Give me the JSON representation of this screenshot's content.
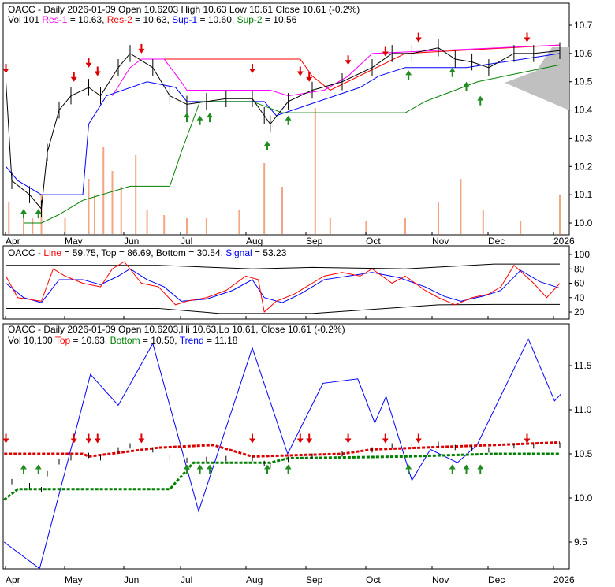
{
  "header1": {
    "line1": "OACC - Daily 2026-01-09 Open 10.6203  High 10.63  Low 10.61  Close 10.61 (-0.2%)",
    "vol": "Vol 101 ",
    "res1": "Res-1",
    "res1v": " = 10.63, ",
    "res2": "Res-2",
    "res2v": " = 10.63, ",
    "sup1": "Sup-1",
    "sup1v": " = 10.60, ",
    "sup2": "Sup-2",
    "sup2v": " = 10.56"
  },
  "header2": {
    "pre": "OACC - ",
    "line": "Line",
    "linev": " = 59.75, Top = 86.69, Bottom = 30.54, ",
    "signal": "Signal",
    "signalv": " = 53.23"
  },
  "header3": {
    "line1": "OACC - Daily 2026-01-09 Open 10.6203,Hi 10.63,Lo 10.61, Close 10.61 (-0.2%)",
    "vol": "Vol 10,100 ",
    "top": "Top",
    "topv": " = 10.63, ",
    "bottom": "Bottom",
    "bottomv": " = 10.50, ",
    "trend": "Trend",
    "trendv": " = 11.18"
  },
  "colors": {
    "res1": "#ff00ff",
    "res2": "#ff0000",
    "sup1": "#0000ff",
    "sup2": "#008000",
    "volume": "#f4a582",
    "up": "#228b22",
    "down": "#dd0000"
  },
  "chart_data": [
    {
      "type": "line",
      "title": "Price with support/resistance",
      "months": [
        "Apr",
        "May",
        "Jun",
        "Jul",
        "Aug",
        "Sep",
        "Oct",
        "Nov",
        "Dec",
        "2026"
      ],
      "y_ticks": [
        "10.7",
        "10.6",
        "10.5",
        "10.4",
        "10.3",
        "10.2",
        "10.1",
        "10.0"
      ],
      "ylim": [
        9.97,
        10.76
      ],
      "price": [
        [
          -0.1,
          10.5
        ],
        [
          0.0,
          10.15
        ],
        [
          0.3,
          10.1
        ],
        [
          0.5,
          10.05
        ],
        [
          0.6,
          10.25
        ],
        [
          0.8,
          10.4
        ],
        [
          1.0,
          10.45
        ],
        [
          1.3,
          10.48
        ],
        [
          1.5,
          10.45
        ],
        [
          1.8,
          10.55
        ],
        [
          2.0,
          10.6
        ],
        [
          2.4,
          10.55
        ],
        [
          2.7,
          10.45
        ],
        [
          3.0,
          10.42
        ],
        [
          3.3,
          10.43
        ],
        [
          3.6,
          10.44
        ],
        [
          4.0,
          10.44
        ],
        [
          4.2,
          10.38
        ],
        [
          4.3,
          10.35
        ],
        [
          4.6,
          10.43
        ],
        [
          5.0,
          10.47
        ],
        [
          5.5,
          10.5
        ],
        [
          6.0,
          10.55
        ],
        [
          6.3,
          10.6
        ],
        [
          6.6,
          10.6
        ],
        [
          7.0,
          10.62
        ],
        [
          7.3,
          10.58
        ],
        [
          7.6,
          10.57
        ],
        [
          7.9,
          10.55
        ],
        [
          8.3,
          10.6
        ],
        [
          8.6,
          10.6
        ],
        [
          9.0,
          10.61
        ]
      ],
      "res2": [
        [
          2.3,
          10.58
        ],
        [
          4.8,
          10.58
        ],
        [
          5.0,
          10.52
        ],
        [
          5.3,
          10.47
        ],
        [
          6.5,
          10.6
        ],
        [
          9.0,
          10.63
        ]
      ],
      "res1": [
        [
          1.7,
          10.45
        ],
        [
          2.0,
          10.55
        ],
        [
          2.2,
          10.58
        ],
        [
          2.6,
          10.58
        ],
        [
          2.9,
          10.5
        ],
        [
          3.0,
          10.47
        ],
        [
          4.3,
          10.47
        ],
        [
          4.6,
          10.45
        ],
        [
          5.2,
          10.47
        ],
        [
          5.6,
          10.52
        ],
        [
          6.0,
          10.6
        ],
        [
          9.0,
          10.63
        ]
      ],
      "sup1": [
        [
          -0.1,
          10.2
        ],
        [
          0.1,
          10.15
        ],
        [
          0.5,
          10.1
        ],
        [
          1.2,
          10.1
        ],
        [
          1.3,
          10.35
        ],
        [
          1.6,
          10.45
        ],
        [
          2.3,
          10.5
        ],
        [
          2.8,
          10.48
        ],
        [
          3.0,
          10.43
        ],
        [
          4.2,
          10.43
        ],
        [
          4.4,
          10.38
        ],
        [
          5.8,
          10.48
        ],
        [
          6.1,
          10.52
        ],
        [
          6.5,
          10.55
        ],
        [
          7.5,
          10.55
        ],
        [
          9.0,
          10.6
        ]
      ],
      "sup2": [
        [
          0.2,
          10.0
        ],
        [
          0.5,
          10.0
        ],
        [
          0.8,
          10.03
        ],
        [
          1.2,
          10.08
        ],
        [
          2.0,
          10.13
        ],
        [
          2.7,
          10.13
        ],
        [
          2.9,
          10.25
        ],
        [
          3.2,
          10.43
        ],
        [
          4.0,
          10.43
        ],
        [
          4.5,
          10.39
        ],
        [
          6.5,
          10.39
        ],
        [
          6.8,
          10.43
        ],
        [
          7.3,
          10.47
        ],
        [
          7.7,
          10.5
        ],
        [
          9.0,
          10.56
        ]
      ],
      "volume": [
        [
          -0.05,
          0.2
        ],
        [
          0.2,
          0.15
        ],
        [
          0.35,
          0.1
        ],
        [
          0.5,
          0.25
        ],
        [
          0.9,
          0.1
        ],
        [
          1.3,
          0.35
        ],
        [
          1.4,
          0.25
        ],
        [
          1.55,
          0.55
        ],
        [
          1.7,
          0.4
        ],
        [
          1.85,
          0.3
        ],
        [
          2.1,
          0.5
        ],
        [
          2.3,
          0.15
        ],
        [
          2.6,
          0.12
        ],
        [
          3.0,
          0.1
        ],
        [
          3.3,
          0.1
        ],
        [
          3.8,
          0.15
        ],
        [
          4.2,
          0.45
        ],
        [
          4.5,
          0.3
        ],
        [
          5.05,
          0.8
        ],
        [
          5.3,
          0.1
        ],
        [
          5.9,
          0.08
        ],
        [
          6.5,
          0.1
        ],
        [
          7.0,
          0.2
        ],
        [
          7.4,
          0.35
        ],
        [
          7.8,
          0.15
        ],
        [
          8.4,
          0.08
        ],
        [
          9.0,
          0.25
        ]
      ],
      "down_arrows": [
        [
          -0.1,
          10.53
        ],
        [
          1.05,
          10.5
        ],
        [
          1.3,
          10.55
        ],
        [
          1.45,
          10.52
        ],
        [
          2.2,
          10.6
        ],
        [
          4.0,
          10.53
        ],
        [
          4.8,
          10.52
        ],
        [
          4.95,
          10.5
        ],
        [
          5.6,
          10.56
        ],
        [
          6.2,
          10.59
        ],
        [
          6.7,
          10.64
        ],
        [
          8.5,
          10.64
        ]
      ],
      "up_arrows": [
        [
          0.2,
          10.05
        ],
        [
          0.45,
          10.05
        ],
        [
          3.0,
          10.39
        ],
        [
          3.2,
          10.38
        ],
        [
          3.35,
          10.39
        ],
        [
          4.25,
          10.29
        ],
        [
          4.6,
          10.38
        ],
        [
          6.55,
          10.54
        ],
        [
          7.25,
          10.55
        ],
        [
          7.5,
          10.5
        ],
        [
          7.75,
          10.45
        ]
      ]
    },
    {
      "type": "line",
      "title": "Oscillator",
      "y_ticks": [
        "100",
        "80",
        "60",
        "40",
        "20"
      ],
      "ylim": [
        10,
        105
      ],
      "line": [
        [
          -0.1,
          70
        ],
        [
          0.1,
          40
        ],
        [
          0.5,
          35
        ],
        [
          0.7,
          80
        ],
        [
          0.9,
          70
        ],
        [
          1.2,
          60
        ],
        [
          1.5,
          55
        ],
        [
          1.7,
          80
        ],
        [
          1.9,
          90
        ],
        [
          2.2,
          60
        ],
        [
          2.5,
          55
        ],
        [
          2.8,
          30
        ],
        [
          3.0,
          35
        ],
        [
          3.3,
          40
        ],
        [
          3.6,
          50
        ],
        [
          3.9,
          70
        ],
        [
          4.1,
          65
        ],
        [
          4.2,
          20
        ],
        [
          4.4,
          35
        ],
        [
          4.7,
          45
        ],
        [
          5.0,
          60
        ],
        [
          5.2,
          70
        ],
        [
          5.5,
          75
        ],
        [
          5.8,
          70
        ],
        [
          6.0,
          80
        ],
        [
          6.3,
          60
        ],
        [
          6.5,
          70
        ],
        [
          6.8,
          50
        ],
        [
          7.0,
          40
        ],
        [
          7.3,
          30
        ],
        [
          7.6,
          40
        ],
        [
          7.9,
          45
        ],
        [
          8.1,
          55
        ],
        [
          8.3,
          85
        ],
        [
          8.6,
          60
        ],
        [
          8.8,
          40
        ],
        [
          9.0,
          59.75
        ]
      ],
      "signal": [
        [
          -0.1,
          60
        ],
        [
          0.2,
          40
        ],
        [
          0.5,
          33
        ],
        [
          0.8,
          65
        ],
        [
          1.2,
          65
        ],
        [
          1.5,
          58
        ],
        [
          1.8,
          70
        ],
        [
          2.0,
          80
        ],
        [
          2.3,
          65
        ],
        [
          2.6,
          55
        ],
        [
          2.9,
          35
        ],
        [
          3.3,
          38
        ],
        [
          3.7,
          50
        ],
        [
          4.0,
          65
        ],
        [
          4.2,
          40
        ],
        [
          4.5,
          33
        ],
        [
          4.8,
          45
        ],
        [
          5.2,
          65
        ],
        [
          5.6,
          70
        ],
        [
          6.0,
          75
        ],
        [
          6.4,
          68
        ],
        [
          6.8,
          55
        ],
        [
          7.1,
          42
        ],
        [
          7.4,
          35
        ],
        [
          7.8,
          42
        ],
        [
          8.1,
          50
        ],
        [
          8.4,
          78
        ],
        [
          8.7,
          62
        ],
        [
          9.0,
          53.23
        ]
      ],
      "top": [
        [
          -0.1,
          85
        ],
        [
          2.5,
          85
        ],
        [
          4.0,
          80
        ],
        [
          5.0,
          82
        ],
        [
          6.5,
          80
        ],
        [
          8.0,
          86.69
        ],
        [
          9.0,
          86.69
        ]
      ],
      "bottom": [
        [
          -0.1,
          25
        ],
        [
          2.5,
          25
        ],
        [
          3.5,
          18
        ],
        [
          5.0,
          18
        ],
        [
          7.0,
          30
        ],
        [
          8.0,
          30.54
        ],
        [
          9.0,
          30.54
        ]
      ]
    },
    {
      "type": "line",
      "title": "Trend",
      "y_ticks": [
        "11.5",
        "11.0",
        "10.5",
        "10.0",
        "9.5"
      ],
      "ylim": [
        9.1,
        11.95
      ],
      "trend": [
        [
          -0.13,
          9.5
        ],
        [
          0.47,
          9.2
        ],
        [
          1.33,
          11.4
        ],
        [
          1.8,
          11.05
        ],
        [
          2.4,
          11.75
        ],
        [
          3.18,
          9.85
        ],
        [
          4.0,
          11.7
        ],
        [
          4.59,
          10.5
        ],
        [
          5.18,
          11.3
        ],
        [
          5.76,
          11.35
        ],
        [
          6.04,
          10.85
        ],
        [
          6.21,
          11.15
        ],
        [
          6.6,
          10.2
        ],
        [
          6.88,
          10.55
        ],
        [
          7.34,
          10.4
        ],
        [
          7.69,
          10.6
        ],
        [
          8.52,
          11.8
        ],
        [
          8.92,
          11.1
        ],
        [
          9.02,
          11.18
        ]
      ],
      "top": [
        [
          -0.13,
          10.5
        ],
        [
          1.2,
          10.5
        ],
        [
          1.3,
          10.47
        ],
        [
          2.5,
          10.57
        ],
        [
          3.4,
          10.6
        ],
        [
          4.0,
          10.47
        ],
        [
          5.5,
          10.5
        ],
        [
          6.0,
          10.55
        ],
        [
          8.0,
          10.6
        ],
        [
          9.0,
          10.63
        ]
      ],
      "bottom": [
        [
          -0.13,
          9.98
        ],
        [
          0.1,
          10.1
        ],
        [
          0.5,
          10.1
        ],
        [
          2.7,
          10.1
        ],
        [
          3.1,
          10.4
        ],
        [
          4.3,
          10.4
        ],
        [
          4.6,
          10.45
        ],
        [
          6.5,
          10.47
        ],
        [
          8.0,
          10.5
        ],
        [
          9.0,
          10.5
        ]
      ]
    }
  ]
}
